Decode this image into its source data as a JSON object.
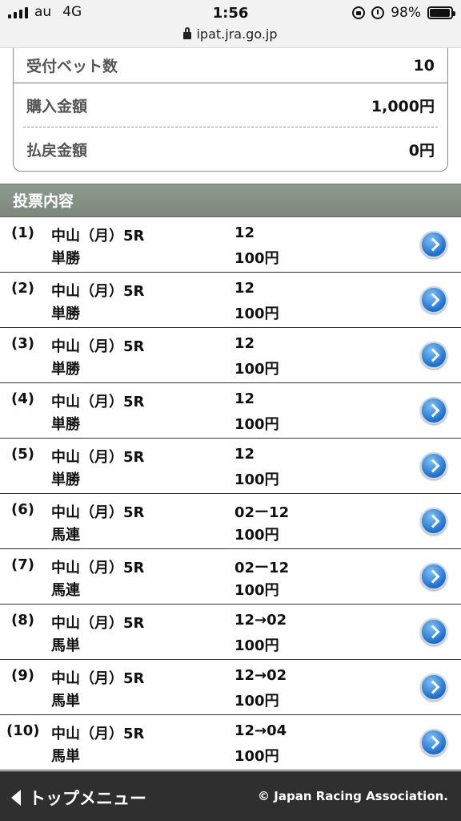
{
  "status": {
    "carrier": "au",
    "network": "4G",
    "time": "1:56",
    "battery": "98%",
    "battery_level": 0.98
  },
  "url": "ipat.jra.go.jp",
  "summary": {
    "bet_count_label": "受付ベット数",
    "bet_count": "10",
    "purchase_label": "購入金額",
    "purchase": "1,000円",
    "payout_label": "払戻金額",
    "payout": "0円"
  },
  "section_title": "投票内容",
  "items": [
    {
      "no": "(1)",
      "race": "中山（月）5R",
      "type": "単勝",
      "combo": "12",
      "amount": "100円"
    },
    {
      "no": "(2)",
      "race": "中山（月）5R",
      "type": "単勝",
      "combo": "12",
      "amount": "100円"
    },
    {
      "no": "(3)",
      "race": "中山（月）5R",
      "type": "単勝",
      "combo": "12",
      "amount": "100円"
    },
    {
      "no": "(4)",
      "race": "中山（月）5R",
      "type": "単勝",
      "combo": "12",
      "amount": "100円"
    },
    {
      "no": "(5)",
      "race": "中山（月）5R",
      "type": "単勝",
      "combo": "12",
      "amount": "100円"
    },
    {
      "no": "(6)",
      "race": "中山（月）5R",
      "type": "馬連",
      "combo": "02ー12",
      "amount": "100円"
    },
    {
      "no": "(7)",
      "race": "中山（月）5R",
      "type": "馬連",
      "combo": "02ー12",
      "amount": "100円"
    },
    {
      "no": "(8)",
      "race": "中山（月）5R",
      "type": "馬単",
      "combo": "12→02",
      "amount": "100円"
    },
    {
      "no": "(9)",
      "race": "中山（月）5R",
      "type": "馬単",
      "combo": "12→02",
      "amount": "100円"
    },
    {
      "no": "(10)",
      "race": "中山（月）5R",
      "type": "馬単",
      "combo": "12→04",
      "amount": "100円"
    }
  ],
  "footer": {
    "top_menu": "トップメニュー",
    "copyright": "© Japan Racing Association."
  }
}
